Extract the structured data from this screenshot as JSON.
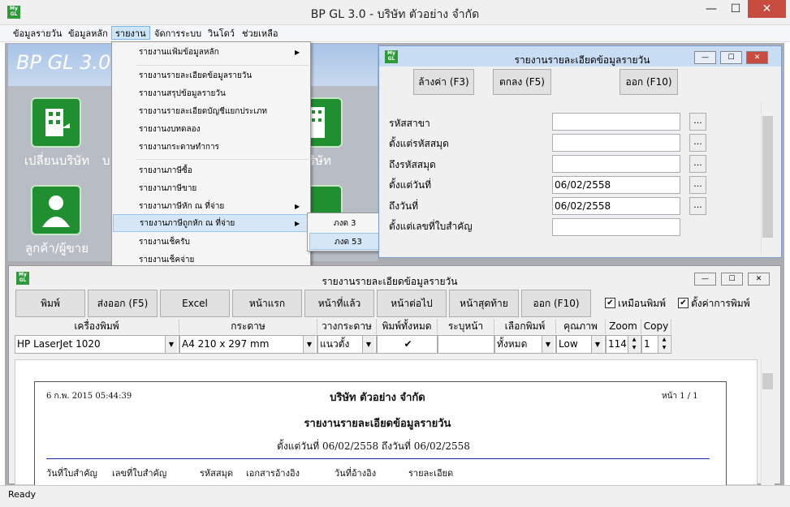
{
  "window": {
    "title": "BP GL 3.0 - บริษัท ตัวอย่าง จำกัด",
    "logo": "My GL",
    "minimize": "—",
    "maximize": "☐",
    "close": "✕"
  },
  "menubar": [
    "ข้อมูลรายวัน",
    "ข้อมูลหลัก",
    "รายงาน",
    "จัดการระบบ",
    "วินโดว์",
    "ช่วยเหลือ"
  ],
  "brand": "BP GL 3.0",
  "tiles": [
    {
      "label": "เปลี่ยนบริษัท",
      "icon": "building-icon"
    },
    {
      "label": "ลูกค้า/ผู้ขาย",
      "icon": "person-icon"
    }
  ],
  "partial_labels": [
    "บ",
    "ริษัท",
    "ด"
  ],
  "report_menu": {
    "items": [
      {
        "label": "รายงานแฟ้มข้อมูลหลัก",
        "arrow": "▶"
      },
      {
        "label": "รายงานรายละเอียดข้อมูลรายวัน"
      },
      {
        "label": "รายงานสรุปข้อมูลรายวัน"
      },
      {
        "label": "รายงานรายละเอียดบัญชีแยกประเภท"
      },
      {
        "label": "รายงานงบทดลอง"
      },
      {
        "label": "รายงานกระดาษทำการ"
      },
      {
        "label": "รายงานภาษีซื้อ"
      },
      {
        "label": "รายงานภาษีขาย"
      },
      {
        "label": "รายงานภาษีหัก ณ ที่จ่าย",
        "arrow": "▶"
      },
      {
        "label": "รายงานภาษีถูกหัก ณ ที่จ่าย",
        "arrow": "▶"
      },
      {
        "label": "รายงานเช็ครับ"
      },
      {
        "label": "รายงานเช็คจ่าย"
      }
    ],
    "submenu": [
      "ภงด 3",
      "ภงด 53"
    ]
  },
  "criteria_dialog": {
    "title": "รายงานรายละเอียดข้อมูลรายวัน",
    "buttons": {
      "clear": "ล้างค่า (F3)",
      "ok": "ตกลง (F5)",
      "exit": "ออก (F10)"
    },
    "fields": [
      {
        "label": "รหัสสาขา",
        "value": ""
      },
      {
        "label": "ตั้งแต่รหัสสมุด",
        "value": ""
      },
      {
        "label": "ถึงรหัสสมุด",
        "value": ""
      },
      {
        "label": "ตั้งแต่วันที่",
        "value": "06/02/2558"
      },
      {
        "label": "ถึงวันที่",
        "value": "06/02/2558"
      },
      {
        "label": "ตั้งแต่เลขที่ใบสำคัญ",
        "value": ""
      }
    ],
    "browse": "..."
  },
  "report_window": {
    "title": "รายงานรายละเอียดข้อมูลรายวัน",
    "toolbar": [
      "พิมพ์",
      "ส่งออก (F5)",
      "Excel",
      "หน้าแรก",
      "หน้าที่แล้ว",
      "หน้าต่อไป",
      "หน้าสุดท้าย",
      "ออก (F10)"
    ],
    "checks": [
      {
        "label": "เหมือนพิมพ์",
        "checked": true
      },
      {
        "label": "ตั้งค่าการพิมพ์",
        "checked": true
      }
    ],
    "headers": [
      "เครื่องพิมพ์",
      "กระดาษ",
      "วางกระดาษ",
      "พิมพ์ทั้งหมด",
      "ระบุหน้า",
      "เลือกพิมพ์",
      "คุณภาพ",
      "Zoom",
      "Copy"
    ],
    "values": {
      "printer": "HP LaserJet 1020",
      "paper": "A4 210 x 297 mm",
      "orientation": "แนวตั้ง",
      "print_all": "✔",
      "pages": "",
      "select": "ทั้งหมด",
      "quality": "Low",
      "zoom": "114",
      "copy": "1"
    }
  },
  "report_page": {
    "datetime": "6 ก.พ. 2015 05:44:39",
    "company": "บริษัท ตัวอย่าง จำกัด",
    "page": "หน้า 1 / 1",
    "title": "รายงานรายละเอียดข้อมูลรายวัน",
    "range": "ตั้งแต่วันที่ 06/02/2558  ถึงวันที่ 06/02/2558",
    "columns": [
      "วันที่ใบสำคัญ",
      "เลขที่ใบสำคัญ",
      "รหัสสมุด",
      "เอกสารอ้างอิง",
      "วันที่อ้างอิง",
      "รายละเอียด"
    ]
  },
  "status": "Ready"
}
